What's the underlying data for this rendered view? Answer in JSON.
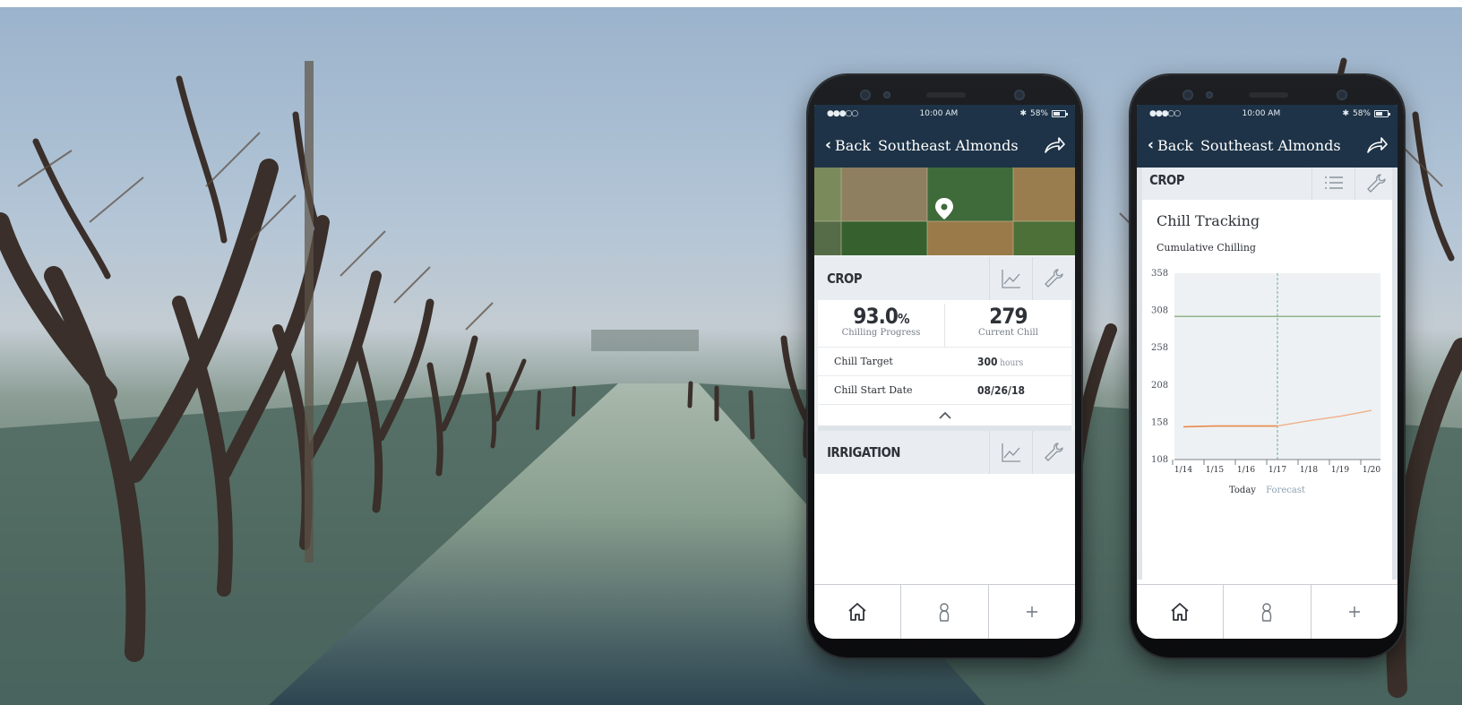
{
  "status_bar": {
    "signal": "●●●○○",
    "time": "10:00 AM",
    "bluetooth": "✱",
    "battery": "58%"
  },
  "nav": {
    "back_label": "Back",
    "title": "Southeast Almonds",
    "share_icon": "share-arrow-icon"
  },
  "crop_section": {
    "title": "CROP",
    "chilling_progress": {
      "value": "93.0",
      "unit": "%",
      "label": "Chilling Progress"
    },
    "current_chill": {
      "value": "279",
      "label": "Current Chill"
    },
    "chill_target": {
      "label": "Chill Target",
      "value": "300",
      "unit": "hours"
    },
    "chill_start_date": {
      "label": "Chill Start Date",
      "value": "08/26/18"
    }
  },
  "irrigation_section": {
    "title": "IRRIGATION"
  },
  "tab_bar": {
    "tabs": [
      "home-icon",
      "person-icon",
      "plus-icon"
    ]
  },
  "chill_tracking": {
    "title": "Chill Tracking",
    "subtitle": "Cumulative Chilling",
    "legend_today": "Today",
    "legend_forecast": "Forecast"
  },
  "colors": {
    "nav_bg": "#1e3347",
    "target_line": "#8fb48a",
    "series_line": "#e98a4d",
    "forecast_line": "#f0b08c",
    "today_marker": "#6fa8a3"
  },
  "chart_data": {
    "type": "line",
    "title": "Cumulative Chilling",
    "categories": [
      "1/14",
      "1/15",
      "1/16",
      "1/17",
      "1/18",
      "1/19",
      "1/20"
    ],
    "y_ticks": [
      "358",
      "308",
      "258",
      "208",
      "158",
      "108"
    ],
    "ylim": [
      108,
      358
    ],
    "series": [
      {
        "values": [
          300,
          300,
          300,
          300,
          300,
          300,
          300
        ]
      },
      {
        "values": [
          152,
          153,
          153,
          153,
          160,
          166,
          174
        ]
      }
    ],
    "today_index": 3,
    "grid": false
  }
}
